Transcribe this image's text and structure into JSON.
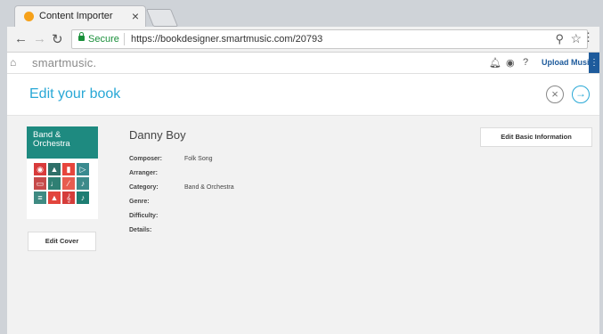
{
  "browser": {
    "tab_title": "Content Importer",
    "tab_close": "×",
    "secure_label": "Secure",
    "url": "https://bookdesigner.smartmusic.com/20793"
  },
  "app": {
    "brand": "smartmusic.",
    "upload_label": "Upload Music"
  },
  "page": {
    "title": "Edit your book"
  },
  "cover": {
    "title_line1": "Band &",
    "title_line2": "Orchestra",
    "edit_label": "Edit Cover",
    "tile_colors": [
      "#d83b3b",
      "#2f6f68",
      "#e7453c",
      "#3a8a8f",
      "#c64a4a",
      "#2f7f73",
      "#e85c50",
      "#3d8a8a",
      "#3f8a82",
      "#e2453d",
      "#d53c3a",
      "#1e7d72"
    ]
  },
  "book": {
    "title": "Danny Boy",
    "edit_basic_label": "Edit Basic Information",
    "fields": [
      {
        "label": "Composer:",
        "value": "Folk Song"
      },
      {
        "label": "Arranger:",
        "value": ""
      },
      {
        "label": "Category:",
        "value": "Band & Orchestra"
      },
      {
        "label": "Genre:",
        "value": ""
      },
      {
        "label": "Difficulty:",
        "value": ""
      },
      {
        "label": "Details:",
        "value": ""
      }
    ]
  }
}
